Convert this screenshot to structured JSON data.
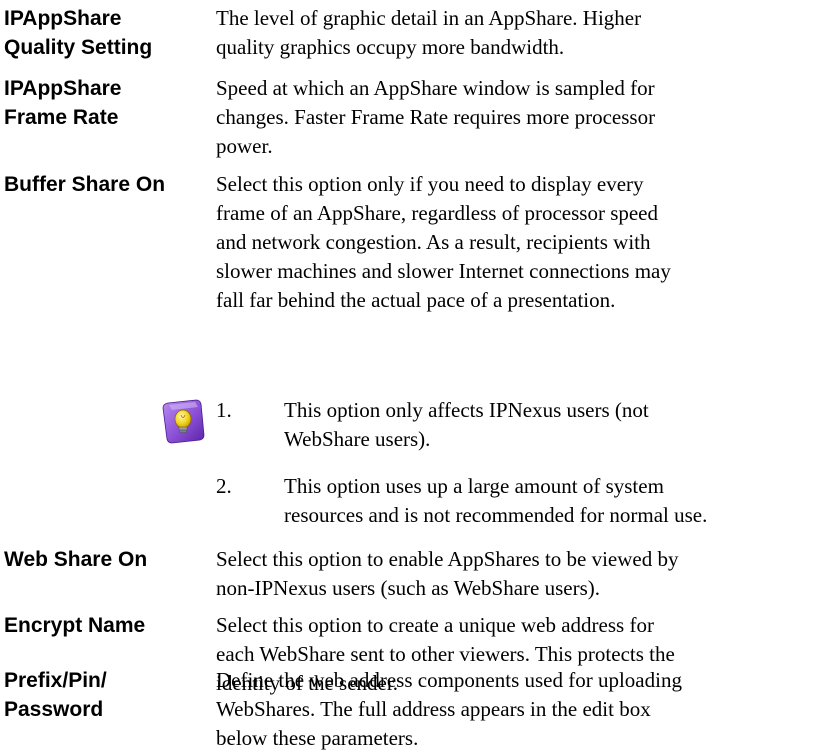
{
  "entries": [
    {
      "term_lines": [
        "IPAppShare",
        "Quality Setting"
      ],
      "def_lines": [
        "The level of graphic detail in an AppShare. Higher",
        "quality graphics occupy more bandwidth."
      ]
    },
    {
      "term_lines": [
        "IPAppShare",
        "Frame Rate"
      ],
      "def_lines": [
        "Speed at which an AppShare window is sampled for",
        "changes. Faster Frame Rate requires more processor",
        "power."
      ]
    },
    {
      "term_lines": [
        "Buffer Share On"
      ],
      "def_lines": [
        "Select this option only if you need to display every",
        "frame of an AppShare, regardless of processor speed",
        "and network congestion. As a result, recipients with",
        "slower machines and slower Internet connections may",
        "fall far behind the actual pace of a presentation."
      ]
    },
    {
      "term_lines": [
        "Web Share On"
      ],
      "def_lines": [
        "Select this option to enable AppShares to be viewed by",
        "non-IPNexus users (such as WebShare users)."
      ]
    },
    {
      "term_lines": [
        "Encrypt Name"
      ],
      "def_lines": [
        "Select this option to create a unique web address for",
        "each WebShare sent to other viewers. This protects the",
        "identity of the sender."
      ]
    },
    {
      "term_lines": [
        "Prefix/Pin/",
        "Password"
      ],
      "def_lines": [
        "Define the web address components used for uploading",
        "WebShares. The full address appears in the edit box",
        "below these parameters."
      ]
    }
  ],
  "notes": [
    {
      "number": "1.",
      "text_lines": [
        "This option only affects IPNexus users (not",
        "WebShare users)."
      ]
    },
    {
      "number": "2.",
      "text_lines": [
        "This option uses up a large amount of system",
        "resources and is not recommended for normal use."
      ]
    }
  ],
  "tip_icon": "lightbulb-tip-icon",
  "colors": {
    "text": "#000000",
    "icon_note": "#8a4fd6",
    "icon_bulb": "#f2d21b"
  }
}
